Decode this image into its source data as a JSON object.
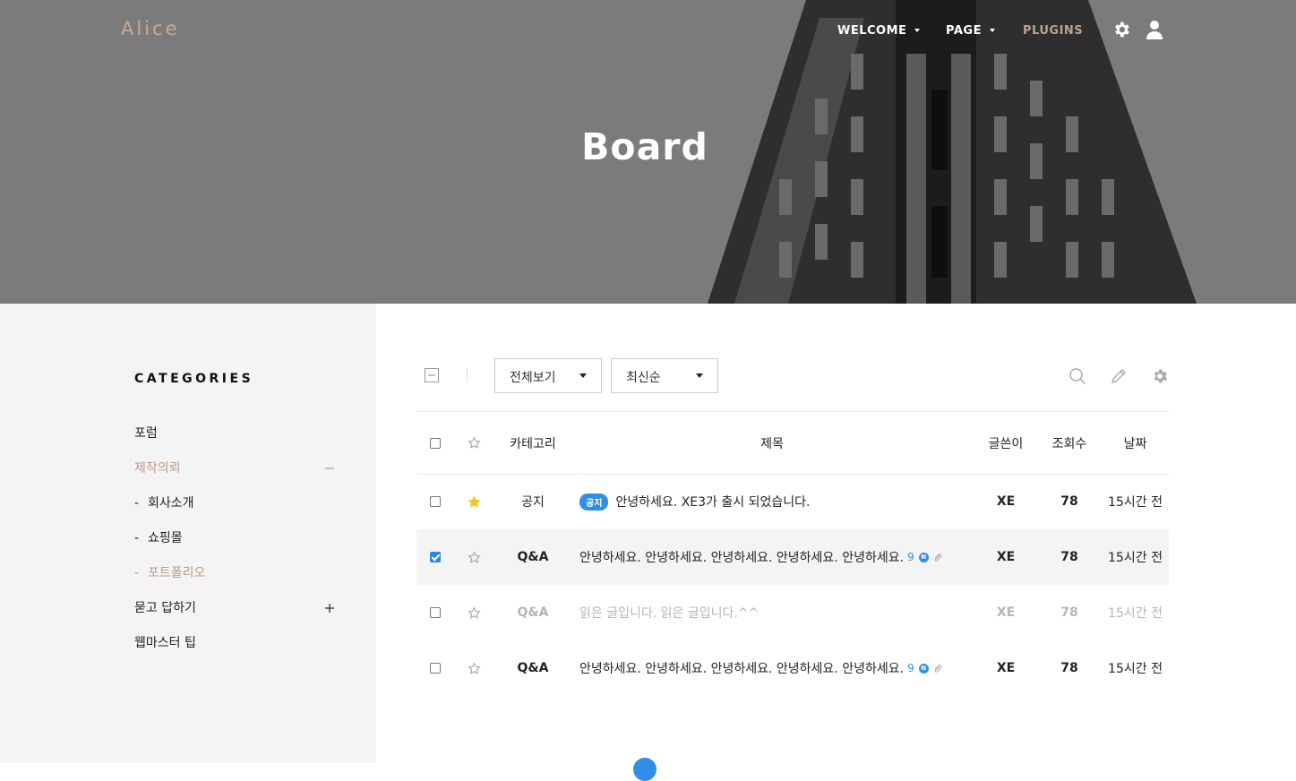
{
  "header": {
    "logo": "Alice",
    "nav": [
      {
        "label": "WELCOME"
      },
      {
        "label": "PAGE"
      },
      {
        "label": "PLUGINS"
      }
    ],
    "title": "Board"
  },
  "sidebar": {
    "heading": "CATEGORIES",
    "items": [
      {
        "label": "포럼"
      },
      {
        "label": "제작의뢰",
        "toggle": "minus"
      },
      {
        "label": "회사소개",
        "prefix": "-"
      },
      {
        "label": "쇼핑몰",
        "prefix": "-"
      },
      {
        "label": "포트폴리오",
        "prefix": "-"
      },
      {
        "label": "묻고 답하기",
        "toggle": "plus"
      },
      {
        "label": "웹마스터 팁"
      }
    ]
  },
  "toolbar": {
    "filter": "전체보기",
    "sort": "최신순"
  },
  "table": {
    "columns": {
      "category": "카테고리",
      "title": "제목",
      "writer": "글쓴이",
      "views": "조회수",
      "date": "날짜"
    },
    "rows": [
      {
        "checked": false,
        "starred": true,
        "category": "공지",
        "notice_badge": "공지",
        "title": "안녕하세요. XE3가 출시 되었습니다.",
        "writer": "XE",
        "views": "78",
        "date": "15시간 전"
      },
      {
        "checked": true,
        "starred": false,
        "category": "Q&A",
        "title": "안녕하세요. 안녕하세요. 안녕하세요. 안녕하세요. 안녕하세요.",
        "comments": "9",
        "new": "N",
        "writer": "XE",
        "views": "78",
        "date": "15시간 전"
      },
      {
        "checked": false,
        "starred": false,
        "read": true,
        "category": "Q&A",
        "title": "읽은 글입니다. 읽은 글입니다.^^",
        "writer": "XE",
        "views": "78",
        "date": "15시간 전"
      },
      {
        "checked": false,
        "starred": false,
        "category": "Q&A",
        "title": "안녕하세요. 안녕하세요. 안녕하세요. 안녕하세요. 안녕하세요.",
        "comments": "9",
        "new": "N",
        "writer": "XE",
        "views": "78",
        "date": "15시간 전"
      }
    ]
  },
  "colors": {
    "accent": "#bc9986",
    "blue": "#2f8fe6",
    "hero_gray": "#7b7b7b"
  }
}
